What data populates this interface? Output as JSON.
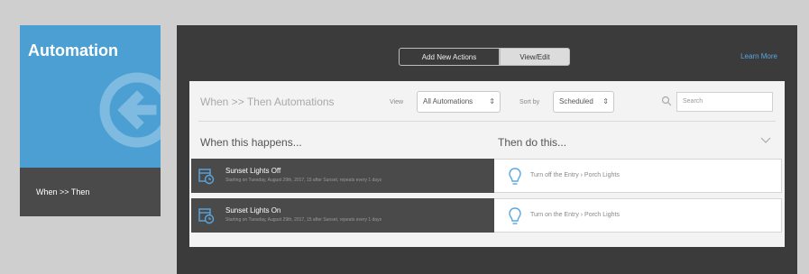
{
  "tile": {
    "title": "Automation",
    "subtitle": "When >> Then",
    "icon": "arrow-left-circle-icon"
  },
  "panel": {
    "tabs": [
      {
        "label": "Add New Actions",
        "active": true
      },
      {
        "label": "View/Edit",
        "active": false
      }
    ],
    "learn_more": "Learn More"
  },
  "card": {
    "title": "When >> Then Automations",
    "view_label": "View",
    "view_value": "All Automations",
    "sort_label": "Sort by",
    "sort_value": "Scheduled",
    "search_placeholder": "Search",
    "col_when": "When this happens...",
    "col_then": "Then do this..."
  },
  "automations": [
    {
      "title": "Sunset Lights Off",
      "desc": "Starting on Tuesday, August 29th, 2017, 15 after Sunset, repeats every 1 days",
      "action": "Turn off the Entry › Porch Lights"
    },
    {
      "title": "Sunset Lights On",
      "desc": "Starting on Tuesday, August 29th, 2017, 15 after Sunset, repeats every 1 days",
      "action": "Turn on the Entry › Porch Lights"
    }
  ],
  "colors": {
    "accent_blue": "#4b9fd2",
    "panel_dark": "#3b3b3b",
    "row_dark": "#4a4a4a",
    "link_blue": "#5aa7e0"
  }
}
